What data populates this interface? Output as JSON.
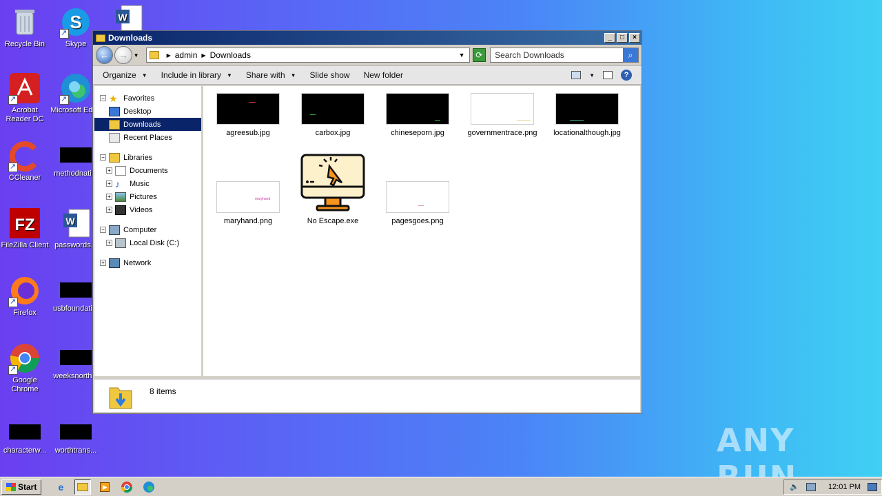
{
  "desktop": {
    "icons": [
      {
        "label": "Recycle Bin"
      },
      {
        "label": "Skype"
      },
      {
        "label": "Acrobat Reader DC"
      },
      {
        "label": "Microsoft Edge"
      },
      {
        "label": "CCleaner"
      },
      {
        "label": "methodnati..."
      },
      {
        "label": "FileZilla Client"
      },
      {
        "label": "passwords..."
      },
      {
        "label": "Firefox"
      },
      {
        "label": "usbfoundati..."
      },
      {
        "label": "Google Chrome"
      },
      {
        "label": "weeksnorth..."
      },
      {
        "label": "characterw..."
      },
      {
        "label": "worthtrans..."
      }
    ],
    "watermark": "ANY RUN"
  },
  "window": {
    "title": "Downloads",
    "address": {
      "crumbs": [
        "admin",
        "Downloads"
      ]
    },
    "search_placeholder": "Search Downloads",
    "commands": {
      "organize": "Organize",
      "include": "Include in library",
      "share": "Share with",
      "slideshow": "Slide show",
      "newfolder": "New folder"
    },
    "nav": {
      "favorites": "Favorites",
      "desktop": "Desktop",
      "downloads": "Downloads",
      "recent": "Recent Places",
      "libraries": "Libraries",
      "documents": "Documents",
      "music": "Music",
      "pictures": "Pictures",
      "videos": "Videos",
      "computer": "Computer",
      "localdisk": "Local Disk (C:)",
      "network": "Network"
    },
    "files": [
      {
        "name": "agreesub.jpg"
      },
      {
        "name": "carbox.jpg"
      },
      {
        "name": "chineseporn.jpg"
      },
      {
        "name": "governmentrace.png"
      },
      {
        "name": "locationalthough.jpg"
      },
      {
        "name": "maryhand.png"
      },
      {
        "name": "No Escape.exe"
      },
      {
        "name": "pagesgoes.png"
      }
    ],
    "thumb_text": {
      "maryhand": "maryhand"
    },
    "status": "8 items"
  },
  "taskbar": {
    "start": "Start",
    "clock": "12:01 PM"
  }
}
